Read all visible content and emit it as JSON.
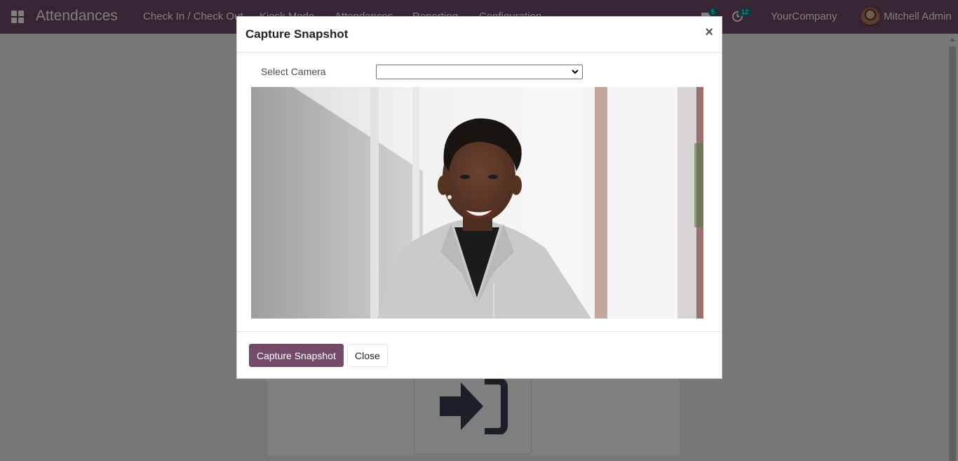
{
  "navbar": {
    "app_name": "Attendances",
    "menu": [
      "Check In / Check Out",
      "Kiosk Mode",
      "Attendances",
      "Reporting",
      "Configuration"
    ],
    "messages_count": "5",
    "activities_count": "12",
    "company": "YourCompany",
    "user": "Mitchell Admin"
  },
  "modal": {
    "title": "Capture Snapshot",
    "close_glyph": "×",
    "camera_label": "Select Camera",
    "camera_selected": "",
    "capture_button": "Capture Snapshot",
    "close_button": "Close"
  },
  "colors": {
    "brand": "#714b67",
    "badge": "#017e84"
  },
  "icons": {
    "apps": "apps-grid-icon",
    "messages": "chat-icon",
    "activities": "clock-icon",
    "kiosk": "sign-in-icon",
    "close": "close-icon"
  }
}
